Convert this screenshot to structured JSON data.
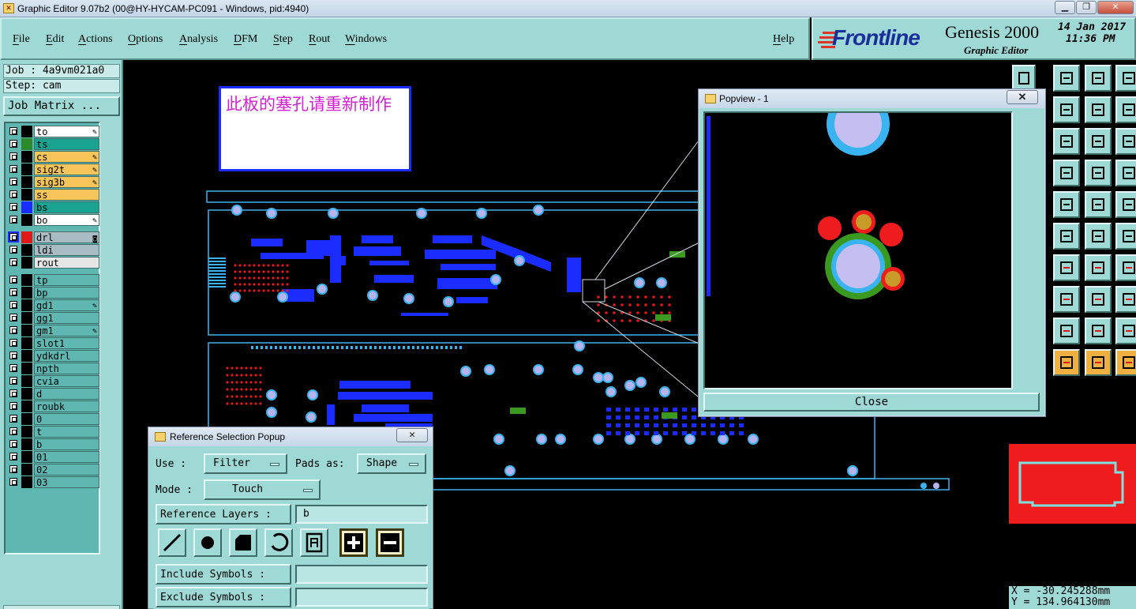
{
  "window": {
    "title": "Graphic Editor 9.07b2 (00@HY-HYCAM-PC091 - Windows, pid:4940)"
  },
  "menu": [
    "File",
    "Edit",
    "Actions",
    "Options",
    "Analysis",
    "DFM",
    "Step",
    "Rout",
    "Windows"
  ],
  "help": "Help",
  "brand": {
    "logo": "Frontline",
    "product": "Genesis 2000",
    "subtitle": "Graphic Editor",
    "date": "14 Jan 2017",
    "time": "11:36 PM"
  },
  "job": {
    "job_label": "Job : 4a9vm021a0",
    "step_label": "Step: cam",
    "matrix_button": "Job Matrix ..."
  },
  "layers": [
    {
      "name": "to",
      "color": "#ffffff",
      "swatch": "#000000",
      "edit": true
    },
    {
      "name": "ts",
      "color": "#1aa390",
      "swatch": "#2c8a2c",
      "edit": false
    },
    {
      "name": "cs",
      "color": "#f7c45a",
      "swatch": "#000000",
      "edit": true
    },
    {
      "name": "sig2t",
      "color": "#f7c45a",
      "swatch": "#000000",
      "edit": true
    },
    {
      "name": "sig3b",
      "color": "#f7c45a",
      "swatch": "#000000",
      "edit": true
    },
    {
      "name": "ss",
      "color": "#f7c45a",
      "swatch": "#000000",
      "edit": false
    },
    {
      "name": "bs",
      "color": "#1aa390",
      "swatch": "#1a2cff",
      "edit": false
    },
    {
      "name": "bo",
      "color": "#ffffff",
      "swatch": "#000000",
      "edit": true
    },
    {
      "name": "drl",
      "color": "#a9bcc4",
      "swatch": "#e01818",
      "edit": false,
      "active": true
    },
    {
      "name": "ldi",
      "color": "#a9bcc4",
      "swatch": "#000000",
      "edit": false
    },
    {
      "name": "rout",
      "color": "#e6e6e6",
      "swatch": "#000000",
      "edit": false
    },
    {
      "name": "tp",
      "color": "#5fb7b2",
      "swatch": "#000000",
      "edit": false
    },
    {
      "name": "bp",
      "color": "#5fb7b2",
      "swatch": "#000000",
      "edit": false
    },
    {
      "name": "gd1",
      "color": "#5fb7b2",
      "swatch": "#000000",
      "edit": true
    },
    {
      "name": "gg1",
      "color": "#5fb7b2",
      "swatch": "#000000",
      "edit": false
    },
    {
      "name": "gm1",
      "color": "#5fb7b2",
      "swatch": "#000000",
      "edit": true
    },
    {
      "name": "slot1",
      "color": "#5fb7b2",
      "swatch": "#000000",
      "edit": false
    },
    {
      "name": "ydkdrl",
      "color": "#5fb7b2",
      "swatch": "#000000",
      "edit": false
    },
    {
      "name": "npth",
      "color": "#5fb7b2",
      "swatch": "#000000",
      "edit": false
    },
    {
      "name": "cvia",
      "color": "#5fb7b2",
      "swatch": "#000000",
      "edit": false
    },
    {
      "name": "d",
      "color": "#5fb7b2",
      "swatch": "#000000",
      "edit": false
    },
    {
      "name": "roubk",
      "color": "#5fb7b2",
      "swatch": "#000000",
      "edit": false
    },
    {
      "name": "0",
      "color": "#5fb7b2",
      "swatch": "#000000",
      "edit": false
    },
    {
      "name": "t",
      "color": "#5fb7b2",
      "swatch": "#000000",
      "edit": false
    },
    {
      "name": "b",
      "color": "#5fb7b2",
      "swatch": "#000000",
      "edit": false
    },
    {
      "name": "01",
      "color": "#5fb7b2",
      "swatch": "#000000",
      "edit": false
    },
    {
      "name": "02",
      "color": "#5fb7b2",
      "swatch": "#000000",
      "edit": false
    },
    {
      "name": "03",
      "color": "#5fb7b2",
      "swatch": "#000000",
      "edit": false
    }
  ],
  "note": {
    "text": "此板的塞孔请重新制作"
  },
  "popview": {
    "title": "Popview - 1",
    "close": "Close"
  },
  "ref_popup": {
    "title": "Reference Selection Popup",
    "use_label": "Use  :",
    "use_value": "Filter",
    "pads_label": "Pads as:",
    "pads_value": "Shape",
    "mode_label": "Mode :",
    "mode_value": "Touch",
    "ref_layers_label": "Reference Layers :",
    "ref_layers_value": "b",
    "include_label": "Include Symbols :",
    "exclude_label": "Exclude Symbols :"
  },
  "coords": {
    "x": "X = -30.245288mm",
    "y": "Y = 134.964130mm"
  },
  "colors": {
    "panel": "#9fd9d6",
    "canvas": "#000000",
    "trace": "#1a2cff",
    "pad": "#b7b2f0",
    "drill": "#e01818"
  }
}
